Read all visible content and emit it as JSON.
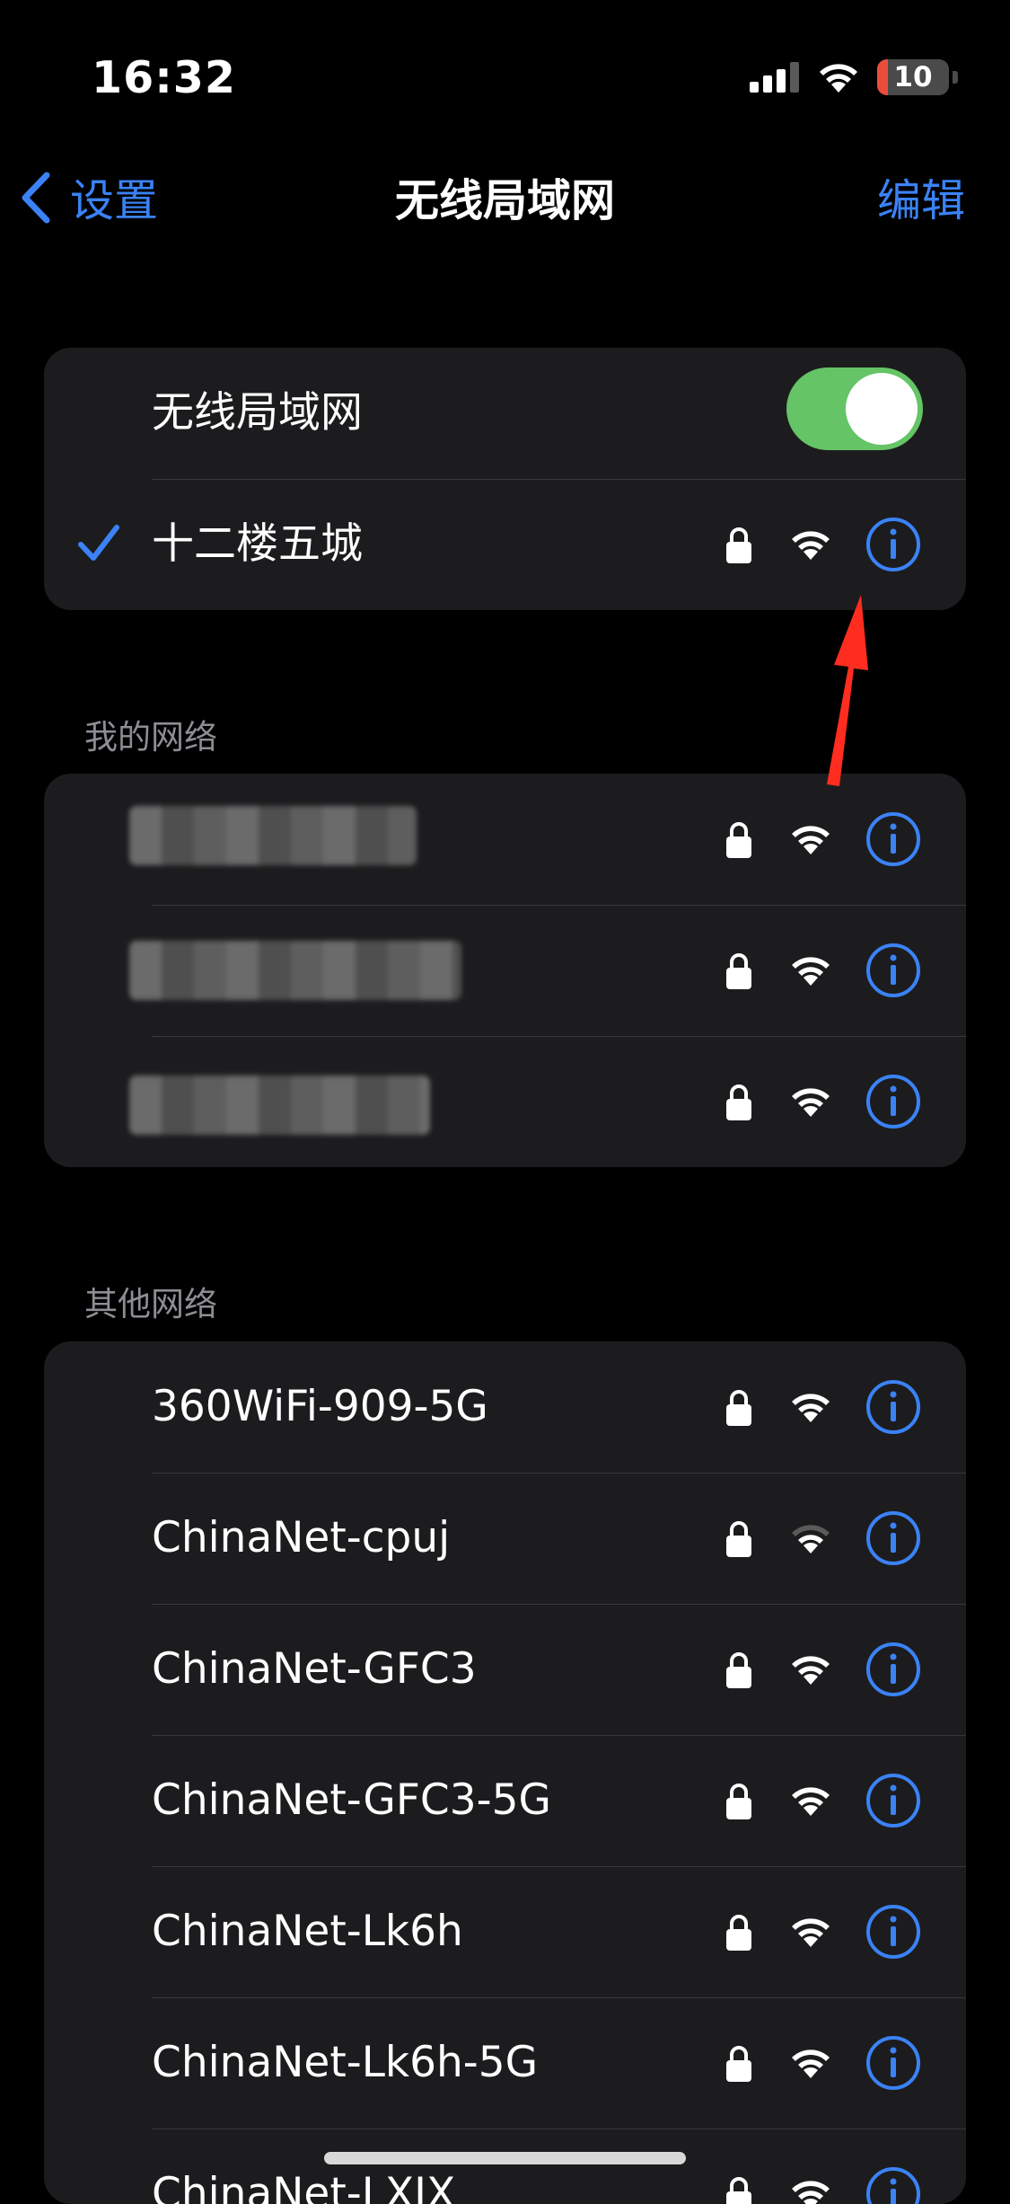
{
  "status_bar": {
    "time": "16:32",
    "battery_level": "10",
    "battery_color": "#eb4d3d"
  },
  "nav": {
    "back_label": "设置",
    "title": "无线局域网",
    "edit_label": "编辑"
  },
  "wifi_group": {
    "toggle_label": "无线局域网",
    "toggle_on": true,
    "connected_network": "十二楼五城"
  },
  "my_networks": {
    "section_title": "我的网络",
    "items": [
      {
        "name_hidden": true,
        "icons": [
          "lock-icon",
          "wifi-icon",
          "info-icon"
        ]
      },
      {
        "name_hidden": true,
        "icons": [
          "lock-icon",
          "wifi-icon",
          "info-icon"
        ]
      },
      {
        "name_hidden": true,
        "icons": [
          "lock-icon",
          "wifi-icon",
          "info-icon"
        ]
      }
    ]
  },
  "other_networks": {
    "section_title": "其他网络",
    "items": [
      {
        "name": "360WiFi-909-5G"
      },
      {
        "name": "ChinaNet-cpuj"
      },
      {
        "name": "ChinaNet-GFC3"
      },
      {
        "name": "ChinaNet-GFC3-5G"
      },
      {
        "name": "ChinaNet-Lk6h"
      },
      {
        "name": "ChinaNet-Lk6h-5G"
      },
      {
        "name": "ChinaNet-LXJX"
      }
    ]
  },
  "colors": {
    "accent": "#3b82f6",
    "toggle_on": "#65c466",
    "annotation_arrow": "#ff2d20"
  }
}
